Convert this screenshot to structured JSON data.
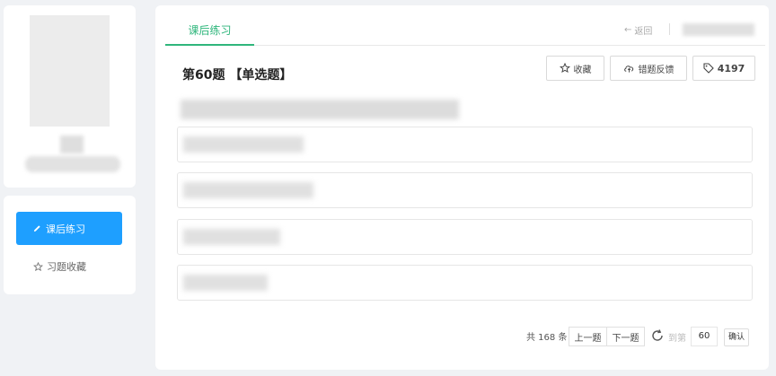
{
  "sidebar": {
    "nav": [
      {
        "label": "课后练习",
        "icon": "pencil-icon",
        "active": true
      },
      {
        "label": "习题收藏",
        "icon": "star-icon",
        "active": false
      }
    ]
  },
  "main": {
    "tab": "课后练习",
    "back": "返回",
    "question_title": "第60题 【单选题】",
    "actions": {
      "favorite": "收藏",
      "report": "错题反馈",
      "tag": "4197"
    },
    "options_count": 4
  },
  "pagination": {
    "total": "共 168 条",
    "prev": "上一题",
    "next": "下一题",
    "goto": "到第",
    "page": "60",
    "confirm": "确认"
  },
  "colors": {
    "accent": "#1e9fff",
    "tab_green": "#2fb67c",
    "background": "#f0f2f5"
  }
}
